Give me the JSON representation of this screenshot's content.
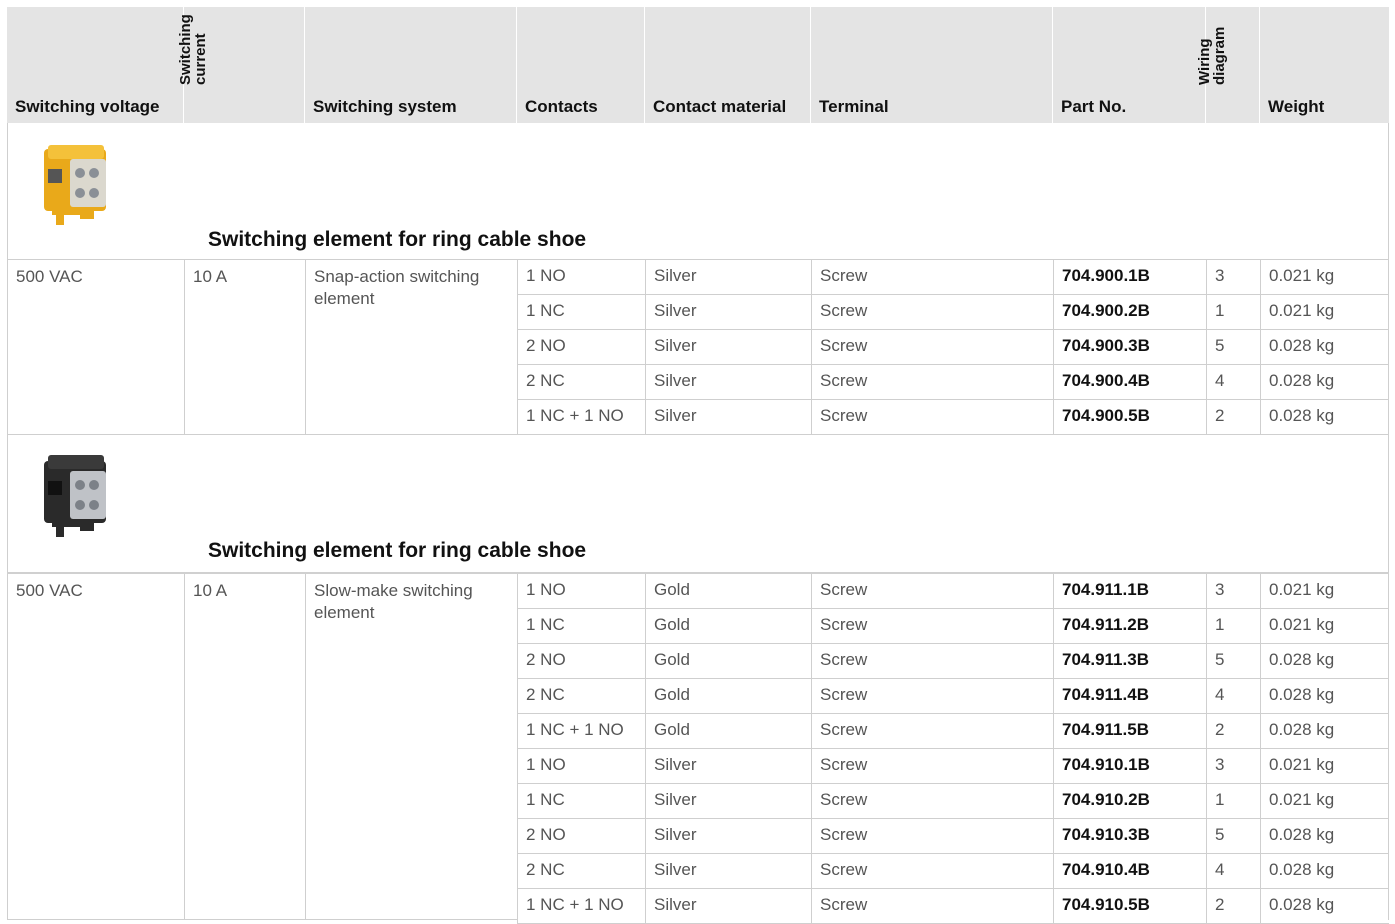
{
  "header": {
    "voltage": "Switching voltage",
    "current_l1": "Switching",
    "current_l2": "current",
    "system": "Switching system",
    "contacts": "Contacts",
    "material": "Contact material",
    "terminal": "Terminal",
    "part": "Part No.",
    "wiring_l1": "Wiring",
    "wiring_l2": "diagram",
    "weight": "Weight"
  },
  "sections": [
    {
      "title": "Switching element for ring cable shoe",
      "image": "yellow-switching-element",
      "voltage": "500 VAC",
      "current": "10 A",
      "system": "Snap-action switching element",
      "rows": [
        {
          "contacts": "1 NO",
          "material": "Silver",
          "terminal": "Screw",
          "part": "704.900.1B",
          "wiring": "3",
          "weight": "0.021 kg"
        },
        {
          "contacts": "1 NC",
          "material": "Silver",
          "terminal": "Screw",
          "part": "704.900.2B",
          "wiring": "1",
          "weight": "0.021 kg"
        },
        {
          "contacts": "2 NO",
          "material": "Silver",
          "terminal": "Screw",
          "part": "704.900.3B",
          "wiring": "5",
          "weight": "0.028 kg"
        },
        {
          "contacts": "2 NC",
          "material": "Silver",
          "terminal": "Screw",
          "part": "704.900.4B",
          "wiring": "4",
          "weight": "0.028 kg"
        },
        {
          "contacts": "1 NC + 1 NO",
          "material": "Silver",
          "terminal": "Screw",
          "part": "704.900.5B",
          "wiring": "2",
          "weight": "0.028 kg"
        }
      ]
    },
    {
      "title": "Switching element for ring cable shoe",
      "image": "black-switching-element",
      "voltage": "500 VAC",
      "current": "10 A",
      "system": "Slow-make switching element",
      "rows": [
        {
          "contacts": "1 NO",
          "material": "Gold",
          "terminal": "Screw",
          "part": "704.911.1B",
          "wiring": "3",
          "weight": "0.021 kg"
        },
        {
          "contacts": "1 NC",
          "material": "Gold",
          "terminal": "Screw",
          "part": "704.911.2B",
          "wiring": "1",
          "weight": "0.021 kg"
        },
        {
          "contacts": "2 NO",
          "material": "Gold",
          "terminal": "Screw",
          "part": "704.911.3B",
          "wiring": "5",
          "weight": "0.028 kg"
        },
        {
          "contacts": "2 NC",
          "material": "Gold",
          "terminal": "Screw",
          "part": "704.911.4B",
          "wiring": "4",
          "weight": "0.028 kg"
        },
        {
          "contacts": "1 NC + 1 NO",
          "material": "Gold",
          "terminal": "Screw",
          "part": "704.911.5B",
          "wiring": "2",
          "weight": "0.028 kg"
        },
        {
          "contacts": "1 NO",
          "material": "Silver",
          "terminal": "Screw",
          "part": "704.910.1B",
          "wiring": "3",
          "weight": "0.021 kg"
        },
        {
          "contacts": "1 NC",
          "material": "Silver",
          "terminal": "Screw",
          "part": "704.910.2B",
          "wiring": "1",
          "weight": "0.021 kg"
        },
        {
          "contacts": "2 NO",
          "material": "Silver",
          "terminal": "Screw",
          "part": "704.910.3B",
          "wiring": "5",
          "weight": "0.028 kg"
        },
        {
          "contacts": "2 NC",
          "material": "Silver",
          "terminal": "Screw",
          "part": "704.910.4B",
          "wiring": "4",
          "weight": "0.028 kg"
        },
        {
          "contacts": "1 NC + 1 NO",
          "material": "Silver",
          "terminal": "Screw",
          "part": "704.910.5B",
          "wiring": "2",
          "weight": "0.028 kg"
        }
      ]
    }
  ]
}
